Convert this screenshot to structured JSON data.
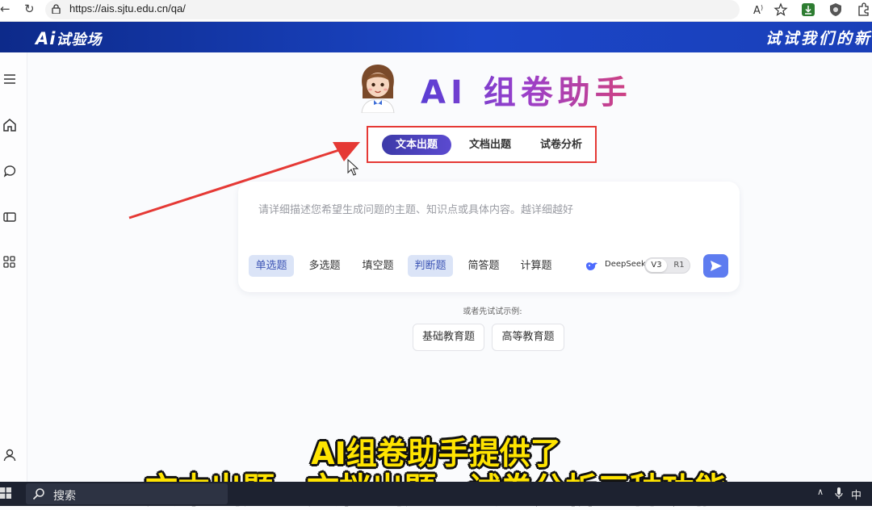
{
  "browser": {
    "url": "https://ais.sjtu.edu.cn/qa/",
    "back_glyph": "←",
    "reload_glyph": "↻"
  },
  "site": {
    "logo_ai": "Ai",
    "logo_text": "试验场",
    "slogan": "试试我们的新"
  },
  "hero": {
    "title": "AI 组卷助手"
  },
  "tabs": [
    {
      "label": "文本出题",
      "active": true
    },
    {
      "label": "文档出题",
      "active": false
    },
    {
      "label": "试卷分析",
      "active": false
    }
  ],
  "input": {
    "placeholder": "请详细描述您希望生成问题的主题、知识点或具体内容。越详细越好"
  },
  "question_types": [
    {
      "label": "单选题",
      "selected": true
    },
    {
      "label": "多选题",
      "selected": false
    },
    {
      "label": "填空题",
      "selected": false
    },
    {
      "label": "判断题",
      "selected": true
    },
    {
      "label": "简答题",
      "selected": false
    },
    {
      "label": "计算题",
      "selected": false
    }
  ],
  "model": {
    "name": "DeepSeek",
    "versions": [
      "V3",
      "R1"
    ],
    "active_version": "V3"
  },
  "examples": {
    "label": "或者先试试示例:",
    "items": [
      "基础教育题",
      "高等教育题"
    ]
  },
  "subtitles": {
    "line1": "AI组卷助手提供了",
    "line2": "文本出题、文档出题、试卷分析三种功能"
  },
  "taskbar": {
    "search_label": "搜索",
    "ime": "中"
  },
  "colors": {
    "brand_blue": "#1b46c8",
    "highlight_red": "#e53935",
    "tab_active": "#4a42bc",
    "subtitle_yellow": "#ffe400",
    "send_button": "#5e7cf0"
  },
  "icons": [
    "back-icon",
    "reload-icon",
    "lock-icon",
    "read-aloud-icon",
    "favorite-icon",
    "download-icon",
    "extension-icon",
    "menu-icon",
    "home-icon",
    "chat-icon",
    "layout-icon",
    "apps-icon",
    "user-icon",
    "deepseek-whale-icon",
    "send-icon",
    "windows-start-icon",
    "search-icon"
  ]
}
